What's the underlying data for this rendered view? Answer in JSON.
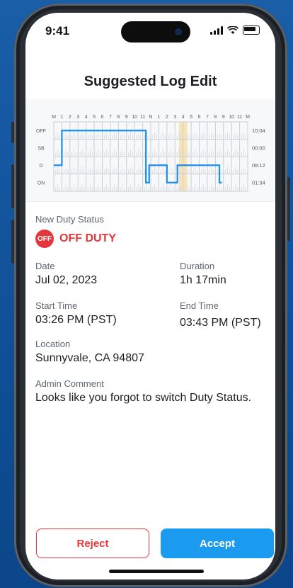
{
  "status_bar": {
    "time": "9:41"
  },
  "header": {
    "title": "Suggested Log Edit"
  },
  "graph": {
    "hour_labels": [
      "M",
      "1",
      "2",
      "3",
      "4",
      "5",
      "6",
      "7",
      "8",
      "9",
      "10",
      "11",
      "N",
      "1",
      "2",
      "3",
      "4",
      "5",
      "6",
      "7",
      "8",
      "9",
      "10",
      "11",
      "M"
    ],
    "rows": [
      "OFF",
      "SB",
      "D",
      "ON"
    ],
    "totals": [
      "10:04",
      "00:00",
      "08:12",
      "01:34"
    ],
    "highlight_hours": [
      15.5,
      16.5
    ],
    "segments": [
      {
        "status": "D",
        "start": 0,
        "end": 1
      },
      {
        "status": "OFF",
        "start": 1,
        "end": 11.4
      },
      {
        "status": "ON",
        "start": 11.4,
        "end": 11.8
      },
      {
        "status": "D",
        "start": 11.8,
        "end": 14
      },
      {
        "status": "ON",
        "start": 14,
        "end": 15.3
      },
      {
        "status": "D",
        "start": 15.3,
        "end": 20.5
      },
      {
        "status": "ON",
        "start": 20.5,
        "end": 20.8
      }
    ],
    "accent_color": "#1a8ef0",
    "highlight_color": "#f8e3b6"
  },
  "details": {
    "new_status_label": "New Duty Status",
    "badge_text": "OFF",
    "status_value": "OFF DUTY",
    "date_label": "Date",
    "date_value": "Jul 02, 2023",
    "duration_label": "Duration",
    "duration_value": "1h 17min",
    "start_label": "Start Time",
    "start_value": "03:26 PM (PST)",
    "end_label": "End Time",
    "end_value": "03:43 PM (PST)",
    "location_label": "Location",
    "location_value": "Sunnyvale, CA 94807",
    "comment_label": "Admin Comment",
    "comment_value": "Looks like you forgot to switch Duty Status."
  },
  "actions": {
    "reject_label": "Reject",
    "accept_label": "Accept"
  },
  "colors": {
    "danger": "#e5363c",
    "primary": "#1a9bf0"
  }
}
